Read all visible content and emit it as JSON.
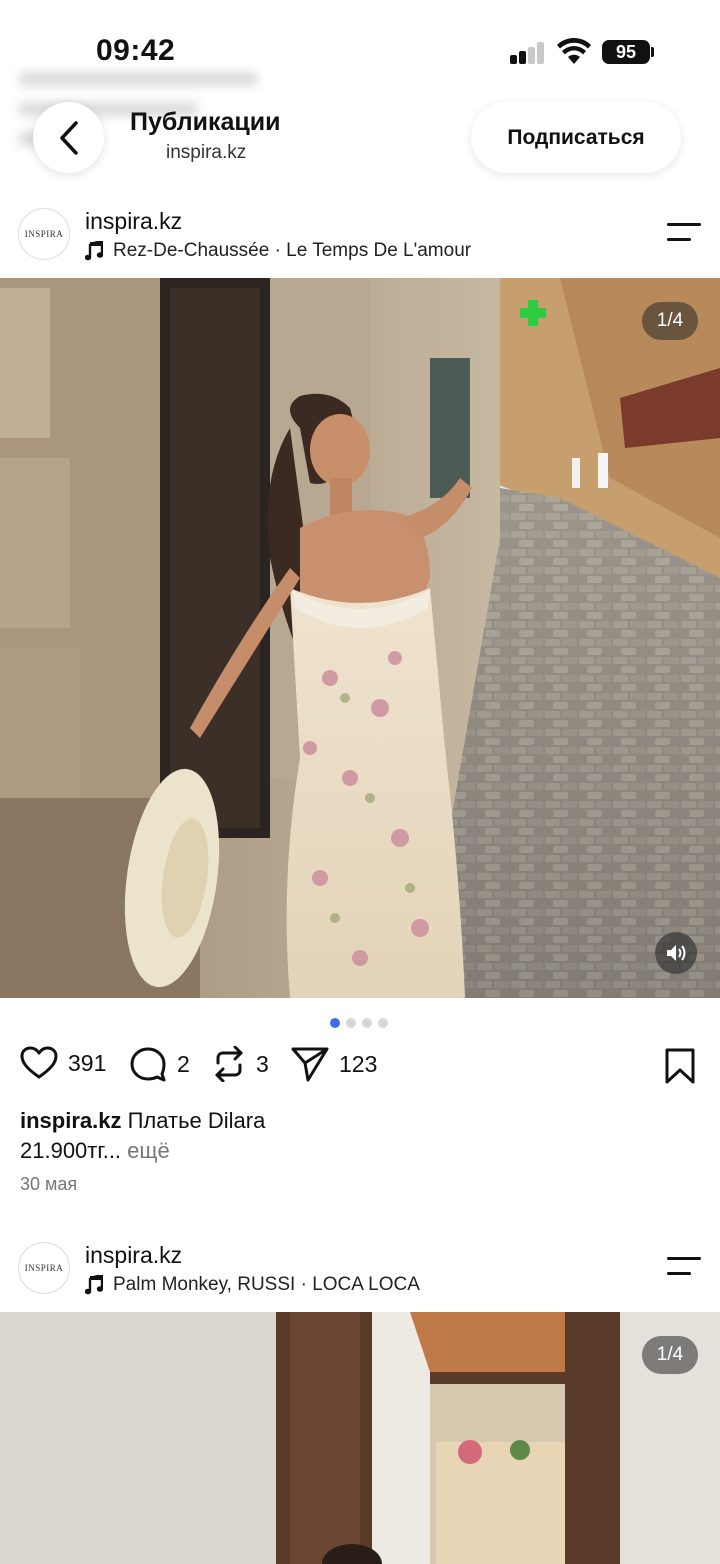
{
  "status_bar": {
    "time": "09:42",
    "battery": "95"
  },
  "header": {
    "title": "Публикации",
    "subtitle": "inspira.kz",
    "subscribe_label": "Подписаться"
  },
  "posts": [
    {
      "avatar_text": "INSPIRA",
      "username": "inspira.kz",
      "music": "Rez-De-Chaussée · Le Temps De L'amour",
      "counter": "1/4",
      "likes": "391",
      "comments": "2",
      "reposts": "3",
      "shares": "123",
      "caption_user": "inspira.kz",
      "caption_text": "Платье Dilara",
      "caption_line2": "21.900тг...",
      "more_label": "ещё",
      "date": "30 мая",
      "carousel_pages": 4,
      "carousel_active": 1
    },
    {
      "avatar_text": "INSPIRA",
      "username": "inspira.kz",
      "music": "Palm Monkey, RUSSI · LOCA LOCA",
      "counter": "1/4"
    }
  ],
  "icons": {
    "back": "chevron-left-icon",
    "music": "music-note-icon",
    "menu": "menu-icon",
    "sound": "speaker-icon",
    "like": "heart-icon",
    "comment": "comment-icon",
    "repost": "repost-icon",
    "share": "send-icon",
    "save": "bookmark-icon"
  },
  "colors": {
    "active_dot": "#3c6df0",
    "muted_text": "#777777"
  }
}
